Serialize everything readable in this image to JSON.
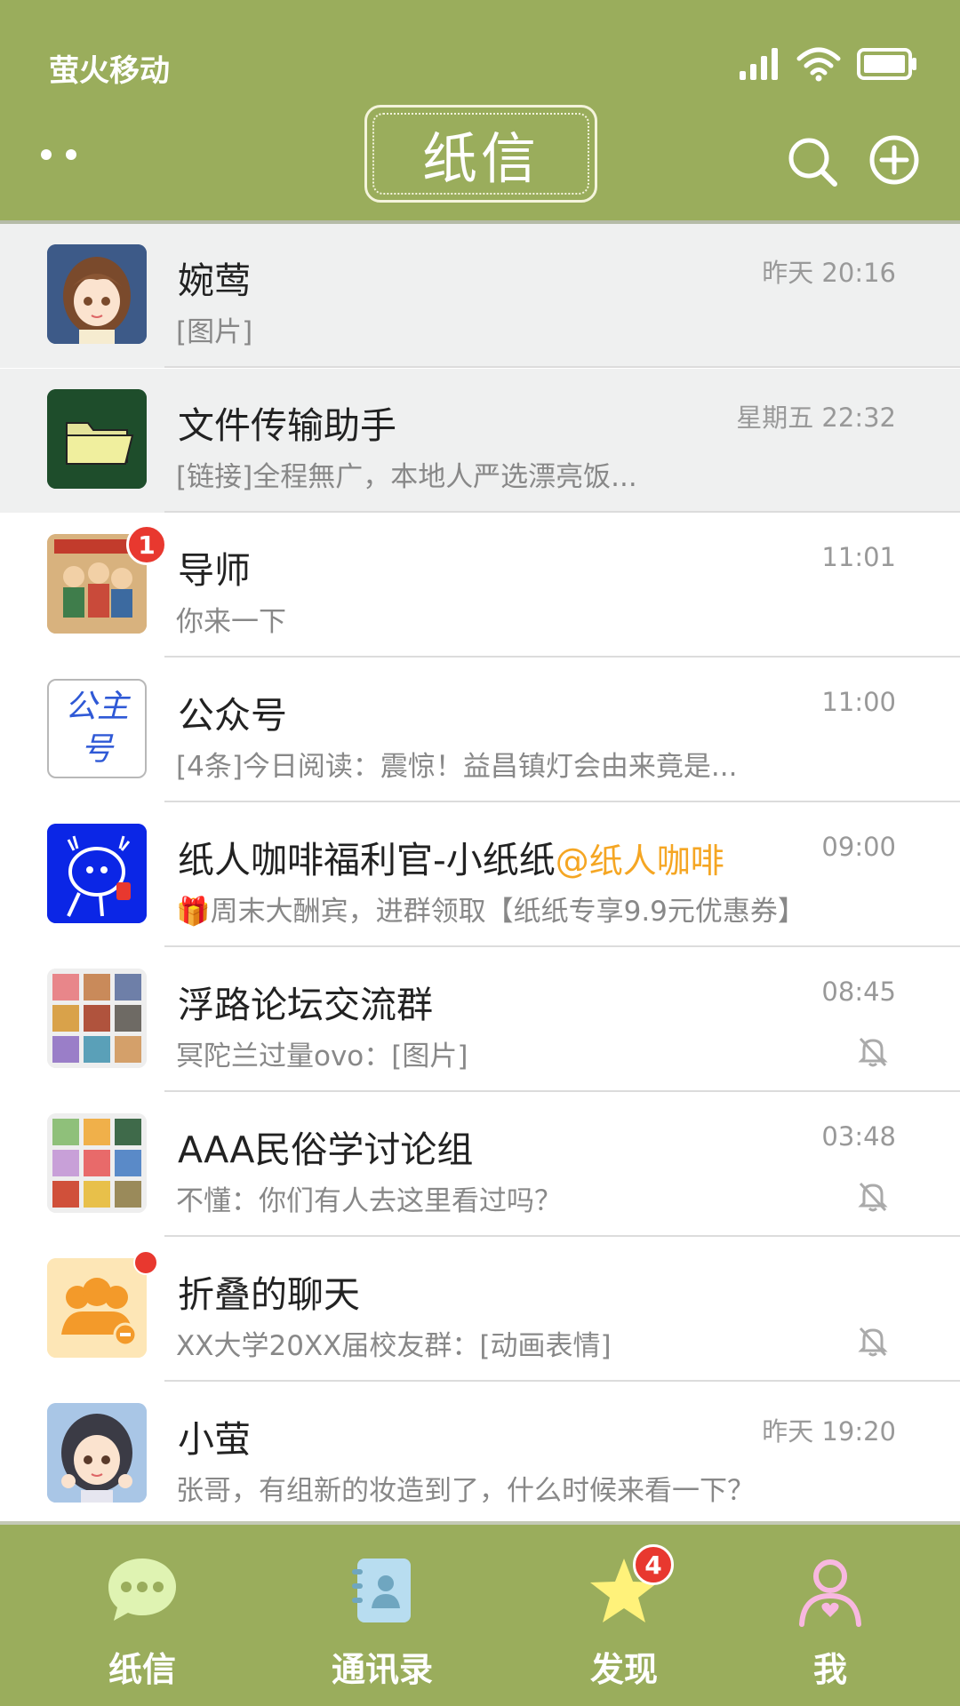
{
  "status_bar": {
    "carrier": "萤火移动",
    "icons": [
      "signal-icon",
      "wifi-icon",
      "battery-icon"
    ]
  },
  "header": {
    "title": "纸信",
    "icons": [
      "menu-dots-icon",
      "search-icon",
      "add-circle-icon"
    ]
  },
  "colors": {
    "brand": "#9aad5c",
    "pinned_bg": "#eff0f0",
    "badge": "#e8382f",
    "mention": "#f5a623"
  },
  "chats": [
    {
      "name": "婉莺",
      "preview": "[图片]",
      "time": "昨天 20:16",
      "pinned": true
    },
    {
      "name": "文件传输助手",
      "preview": "[链接]全程無广，本地人严选漂亮饭...",
      "time": "星期五 22:32",
      "pinned": true
    },
    {
      "name": "导师",
      "preview": "你来一下",
      "time": "11:01",
      "badge": "1"
    },
    {
      "name": "公众号",
      "preview": "[4条]今日阅读：震惊！益昌镇灯会由来竟是...",
      "time": "11:00",
      "avatar_text": "公主号"
    },
    {
      "name": "纸人咖啡福利官-小纸纸",
      "mention": "@纸人咖啡",
      "preview": "🎁周末大酬宾，进群领取【纸纸专享9.9元优惠券】",
      "time": "09:00"
    },
    {
      "name": "浮路论坛交流群",
      "preview": "冥陀兰过量ovo：[图片]",
      "time": "08:45",
      "muted": true
    },
    {
      "name": "AAA民俗学讨论组",
      "preview": "不懂：你们有人去这里看过吗？",
      "time": "03:48",
      "muted": true
    },
    {
      "name": "折叠的聊天",
      "preview": "XX大学20XX届校友群：[动画表情]",
      "time": "",
      "muted": true,
      "dot": true
    },
    {
      "name": "小萤",
      "preview": "张哥，有组新的妆造到了，什么时候来看一下？",
      "time": "昨天 19:20"
    }
  ],
  "tabs": [
    {
      "label": "纸信",
      "icon": "chat-bubble-icon"
    },
    {
      "label": "通讯录",
      "icon": "contacts-book-icon"
    },
    {
      "label": "发现",
      "icon": "star-icon",
      "badge": "4"
    },
    {
      "label": "我",
      "icon": "person-icon"
    }
  ]
}
